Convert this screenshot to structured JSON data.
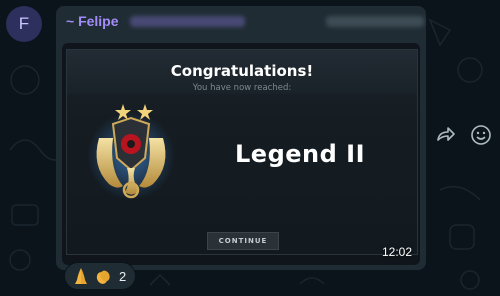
{
  "avatar": {
    "letter": "F"
  },
  "message": {
    "sender": "~ Felipe",
    "time": "12:02",
    "media": {
      "title": "Congratulations!",
      "subtitle": "You have now reached:",
      "rank": "Legend II",
      "button": "CONTINUE"
    }
  },
  "reactions": {
    "count": "2",
    "emojis": [
      "folded-hands-emoji",
      "clapping-hands-emoji"
    ]
  },
  "colors": {
    "bg": "#0b141a",
    "bubble": "#1f2c34",
    "sender": "#a28cf7",
    "avatar_bg": "#2d2f5c"
  }
}
